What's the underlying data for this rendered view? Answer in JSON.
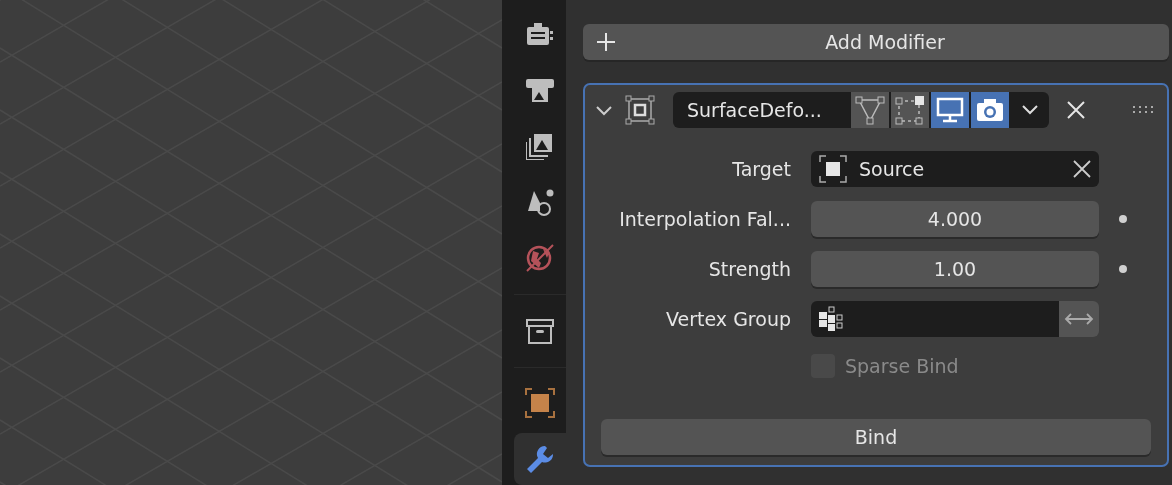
{
  "tab_groups": [
    [
      {
        "kind": "render",
        "selected": false
      },
      {
        "kind": "output",
        "selected": false
      },
      {
        "kind": "view_layer",
        "selected": false
      },
      {
        "kind": "scene",
        "selected": false
      },
      {
        "kind": "world",
        "selected": false
      }
    ],
    [
      {
        "kind": "collection",
        "selected": false
      }
    ],
    [
      {
        "kind": "object",
        "selected": false
      },
      {
        "kind": "modifier",
        "selected": true
      }
    ]
  ],
  "add_modifier": {
    "label": "Add Modifier"
  },
  "modifier": {
    "expanded": true,
    "name": "SurfaceDefo...",
    "toggles": [
      {
        "kind": "edit_mode",
        "on": false
      },
      {
        "kind": "cage",
        "on": false
      },
      {
        "kind": "viewport",
        "on": true
      },
      {
        "kind": "render",
        "on": true
      }
    ],
    "target": {
      "label": "Target",
      "value": "Source"
    },
    "fields": [
      {
        "label": "Interpolation Fal...",
        "value": "4.000"
      },
      {
        "label": "Strength",
        "value": "1.00"
      }
    ],
    "vertex_group": {
      "label": "Vertex Group",
      "invert": false
    },
    "sparse_bind": {
      "label": "Sparse Bind",
      "checked": false,
      "disabled": true
    },
    "bind_button": {
      "label": "Bind"
    }
  }
}
